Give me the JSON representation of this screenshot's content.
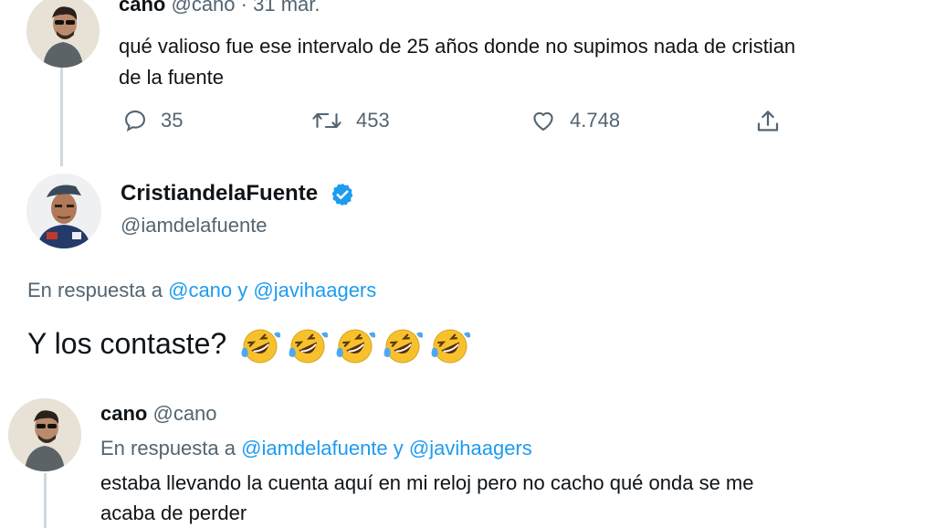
{
  "tweet1": {
    "name": "cano",
    "handle": "@cano",
    "separator": "·",
    "date": "31 mar.",
    "text_line1": "qué valioso fue ese intervalo de 25 años donde no supimos nada de cristian",
    "text_line2": "de la fuente",
    "reply_count": "35",
    "retweet_count": "453",
    "like_count": "4.748"
  },
  "tweet2": {
    "name": "CristiandelaFuente",
    "handle": "@iamdelafuente",
    "reply_prefix": "En respuesta a",
    "mention1": "@cano",
    "conj": "y",
    "mention2": "@javihaagers",
    "text": "Y los contaste?",
    "emoji_name": "rolling-on-the-floor-laughing-emoji",
    "emoji_count": 5
  },
  "tweet3": {
    "name": "cano",
    "handle": "@cano",
    "reply_prefix": "En respuesta a",
    "mention1": "@iamdelafuente",
    "conj": "y",
    "mention2": "@javihaagers",
    "text_line1": "estaba llevando la cuenta aquí en mi reloj pero no cacho qué onda se me",
    "text_line2": "acaba de perder"
  },
  "colors": {
    "accent": "#1d9bf0",
    "muted": "#536471",
    "text": "#0f1419"
  }
}
